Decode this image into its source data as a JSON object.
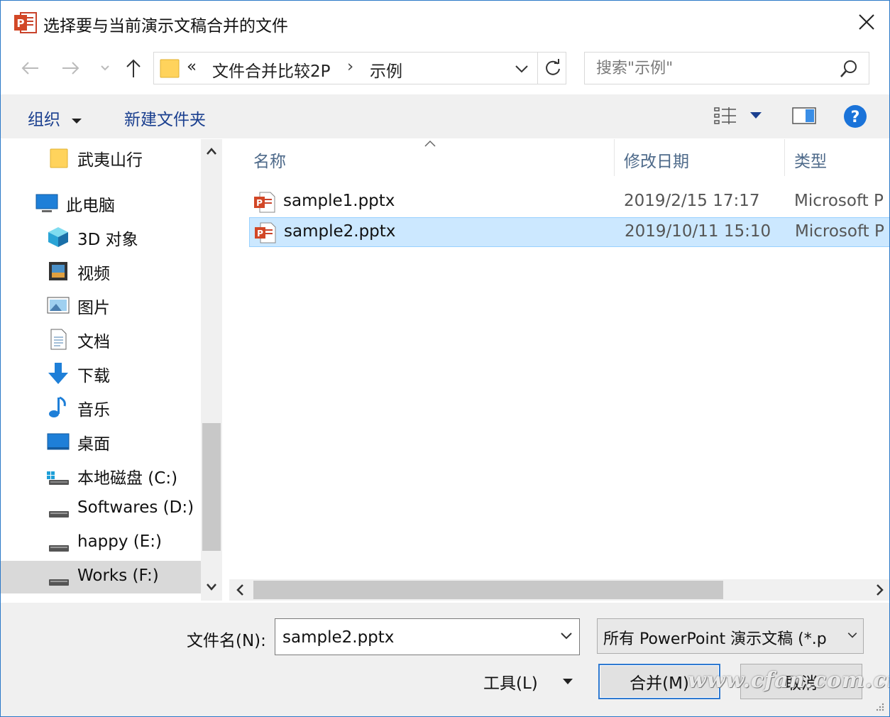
{
  "window": {
    "title": "选择要与当前演示文稿合并的文件",
    "app_icon": "powerpoint-icon"
  },
  "address": {
    "overflow": "«",
    "crumbs": [
      "文件合并比较2P",
      "示例"
    ],
    "separator": "›"
  },
  "search": {
    "placeholder": "搜索\"示例\""
  },
  "toolbar": {
    "organize": "组织",
    "new_folder": "新建文件夹"
  },
  "nav": {
    "items": [
      {
        "label": "武夷山行",
        "icon": "folder-icon"
      },
      {
        "label": "此电脑",
        "icon": "computer-icon"
      },
      {
        "label": "3D 对象",
        "icon": "3d-objects-icon"
      },
      {
        "label": "视频",
        "icon": "video-icon"
      },
      {
        "label": "图片",
        "icon": "pictures-icon"
      },
      {
        "label": "文档",
        "icon": "documents-icon"
      },
      {
        "label": "下载",
        "icon": "download-icon"
      },
      {
        "label": "音乐",
        "icon": "music-icon"
      },
      {
        "label": "桌面",
        "icon": "desktop-icon"
      },
      {
        "label": "本地磁盘 (C:)",
        "icon": "system-drive-icon"
      },
      {
        "label": "Softwares (D:)",
        "icon": "drive-icon"
      },
      {
        "label": "happy (E:)",
        "icon": "drive-icon"
      },
      {
        "label": "Works (F:)",
        "icon": "drive-icon"
      }
    ],
    "selected": "Works (F:)"
  },
  "columns": {
    "name": "名称",
    "modified": "修改日期",
    "type": "类型"
  },
  "files": [
    {
      "name": "sample1.pptx",
      "modified": "2019/2/15 17:17",
      "type": "Microsoft P"
    },
    {
      "name": "sample2.pptx",
      "modified": "2019/10/11 15:10",
      "type": "Microsoft P"
    }
  ],
  "selected_file": "sample2.pptx",
  "bottom": {
    "filename_label": "文件名(N):",
    "filename_value": "sample2.pptx",
    "filetype": "所有 PowerPoint 演示文稿 (*.p",
    "tools_label": "工具(L)",
    "merge_button": "合并(M)",
    "cancel_button": "取消"
  },
  "watermark": "www.cfan.com.cn",
  "colors": {
    "accent": "#2f7ad1",
    "selection_bg": "#cce8ff",
    "selection_border": "#99d1ff",
    "link_text": "#1a3f8f",
    "help_blue": "#1a73d9"
  }
}
